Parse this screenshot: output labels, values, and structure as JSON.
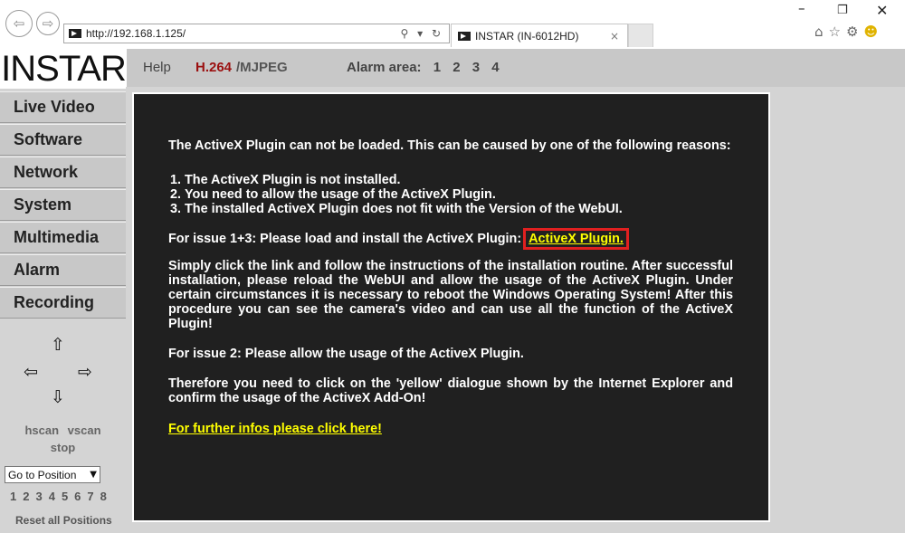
{
  "browser": {
    "url": "http://192.168.1.125/",
    "address_tools": "⚲ ▾ ↻",
    "tab_title": "INSTAR (IN-6012HD)",
    "tab_close": "×",
    "window_controls": {
      "minimize": "–",
      "restore": "❐",
      "close": "✕"
    },
    "toolbar_icons": [
      "home-icon",
      "star-icon",
      "gear-icon",
      "smiley-icon"
    ]
  },
  "header": {
    "logo": "INSTAR",
    "help": "Help",
    "h264": "H.264",
    "mjpeg": "/MJPEG",
    "alarm_label": "Alarm area:",
    "alarm_areas": [
      "1",
      "2",
      "3",
      "4"
    ]
  },
  "sidebar": {
    "menu": [
      "Live Video",
      "Software",
      "Network",
      "System",
      "Multimedia",
      "Alarm",
      "Recording"
    ],
    "ptz_up": "⇧",
    "ptz_left": "⇦",
    "ptz_right": "⇨",
    "ptz_down": "⇩",
    "hscan": "hscan",
    "vscan": "vscan",
    "stop": "stop",
    "goto_select": "Go to Position",
    "positions": [
      "1",
      "2",
      "3",
      "4",
      "5",
      "6",
      "7",
      "8"
    ],
    "reset": "Reset all Positions"
  },
  "content": {
    "intro": "The ActiveX Plugin can not be loaded. This can be caused by one of the following reasons:",
    "reasons": [
      "The ActiveX Plugin is not installed.",
      "You need to allow the usage of the ActiveX Plugin.",
      "The installed ActiveX Plugin does not fit with the Version of the WebUI."
    ],
    "issue13": "For issue 1+3: Please load and install the ActiveX Plugin:",
    "activex_link": "ActiveX Plugin.",
    "instructions": "Simply click the link and follow the instructions of the installation routine. After successful installation, please reload the WebUI and allow the usage of the ActiveX Plugin. Under certain circumstances it is necessary to reboot the Windows Operating System! After this procedure you can see the camera's video and can use all the function of the ActiveX Plugin!",
    "issue2": "For issue 2: Please allow the usage of the ActiveX Plugin.",
    "therefore": "Therefore you need to click on the 'yellow' dialogue shown by the Internet Explorer and confirm the usage of the ActiveX Add-On!",
    "further_link": "For further infos please click here!"
  },
  "colors": {
    "panel_bg": "#202020",
    "link_yellow": "#ffff00",
    "highlight_red": "#e02020",
    "h264_red": "#9b1010",
    "sidebar_gray": "#c8c8c8"
  }
}
